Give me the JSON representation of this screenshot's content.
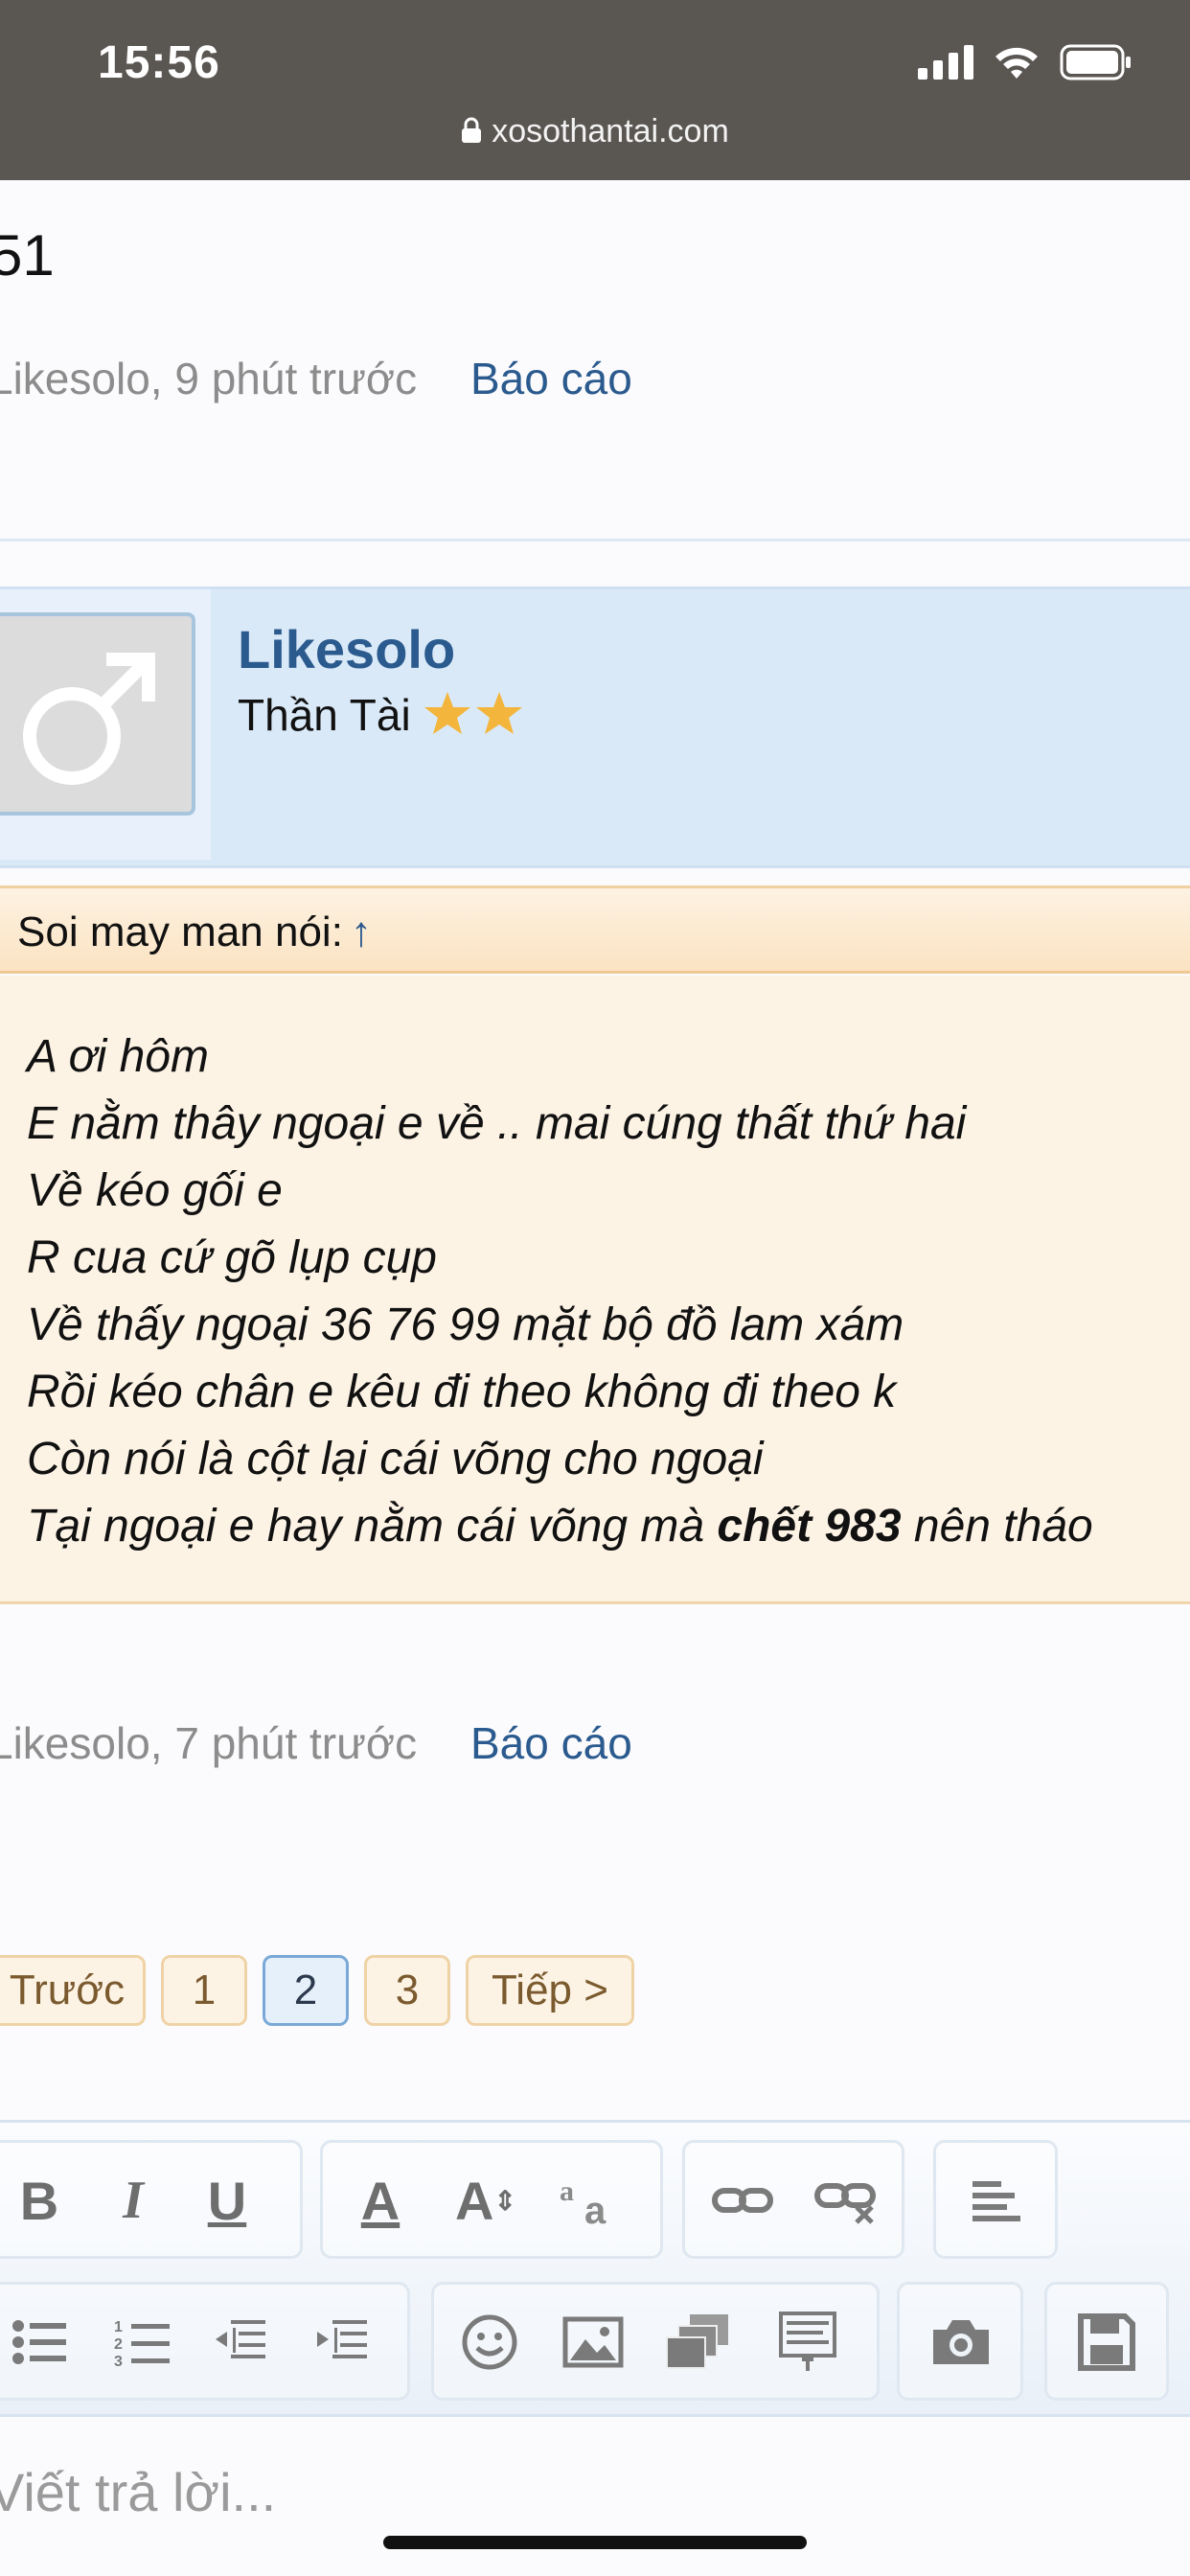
{
  "status_bar": {
    "time": "15:56",
    "url": "xosothantai.com"
  },
  "prev_post": {
    "number_tail": "51",
    "author_time": "Likesolo, 9 phút trước",
    "report": "Báo cáo"
  },
  "post": {
    "username": "Likesolo",
    "user_title": "Thần Tài",
    "rating_stars": 2,
    "quote_author": "Soi may man nói:",
    "quote_arrow": "↑",
    "quote_lines": [
      "A ơi hôm",
      "E nằm thây ngoại e về .. mai cúng thất thứ hai",
      "Về kéo gối e",
      "R cua cứ gõ lụp cụp",
      "Về thấy ngoại 36 76 99 mặt bộ đồ lam xám",
      "Rồi kéo chân e kêu đi theo không đi theo k",
      "Còn nói là cột lại cái võng cho ngoại"
    ],
    "last_line_start": "Tại ngoại e hay nằm cái võng mà ",
    "last_line_bold": "chết 983",
    "last_line_end": " nên tháo",
    "author_time": "Likesolo, 7 phút trước",
    "report": "Báo cáo"
  },
  "pagination": {
    "prev": "Trước",
    "pages": [
      "1",
      "2",
      "3"
    ],
    "active": "2",
    "next": "Tiếp >"
  },
  "editor": {
    "bold": "B",
    "italic": "I",
    "underline": "U",
    "font_color": "A",
    "font_size": "A",
    "placeholder": "Viết trả lời..."
  },
  "colors": {
    "link": "#2b5a8e",
    "status_bar": "#5a5652",
    "quote_bg": "#fdf3e5",
    "user_card_bg": "#dae9f8"
  }
}
